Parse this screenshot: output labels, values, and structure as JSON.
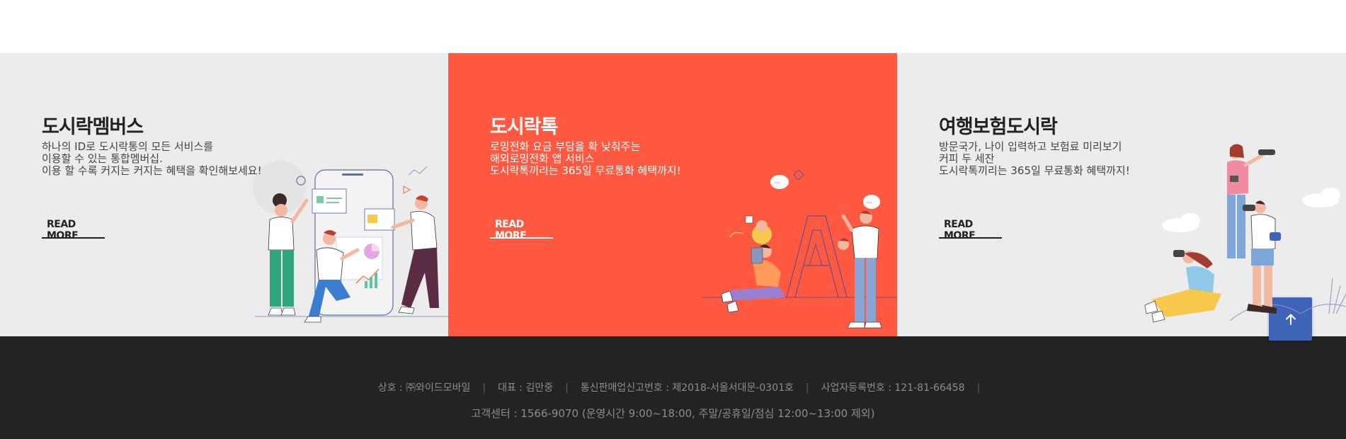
{
  "panels": [
    {
      "title": "도시락멤버스",
      "desc": [
        "하나의 ID로 도시락통의 모든 서비스를",
        "이용할 수 있는 통합멤버십.",
        "이용 할 수록 커지는 커지는 혜택을 확인해보세요!"
      ],
      "read_more": "READ MORE"
    },
    {
      "title": "도시락톡",
      "desc": [
        "로밍전화 요금 부담을 확 낮춰주는",
        "해외로밍전화 앱 서비스",
        "도시락톡끼리는 365일 무료통화 혜택까지!"
      ],
      "read_more": "READ MORE"
    },
    {
      "title": "여행보험도시락",
      "desc": [
        "방문국가, 나이 입력하고 보험료 미리보기",
        "커피 두 세잔",
        "도시락톡끼리는 365일 무료통화 혜택까지!"
      ],
      "read_more": "READ MORE"
    }
  ],
  "footer": {
    "company": "상호 : ㈜와이드모바일",
    "ceo": "대표 : 김만중",
    "ecommerce_reg": "통신판매업신고번호 : 제2018-서울서대문-0301호",
    "business_reg": "사업자등록번호 : 121-81-66458",
    "customer_center": "고객센터 : 1566-9070 (운영시간 9:00~18:00, 주말/공휴일/점심 12:00~13:00 제외)"
  },
  "icons": {
    "scroll_top": "arrow-up-icon"
  },
  "colors": {
    "panel_gray": "#ececec",
    "panel_red": "#ff5a41",
    "footer_bg": "#232323",
    "top_button": "#3e64b8"
  }
}
